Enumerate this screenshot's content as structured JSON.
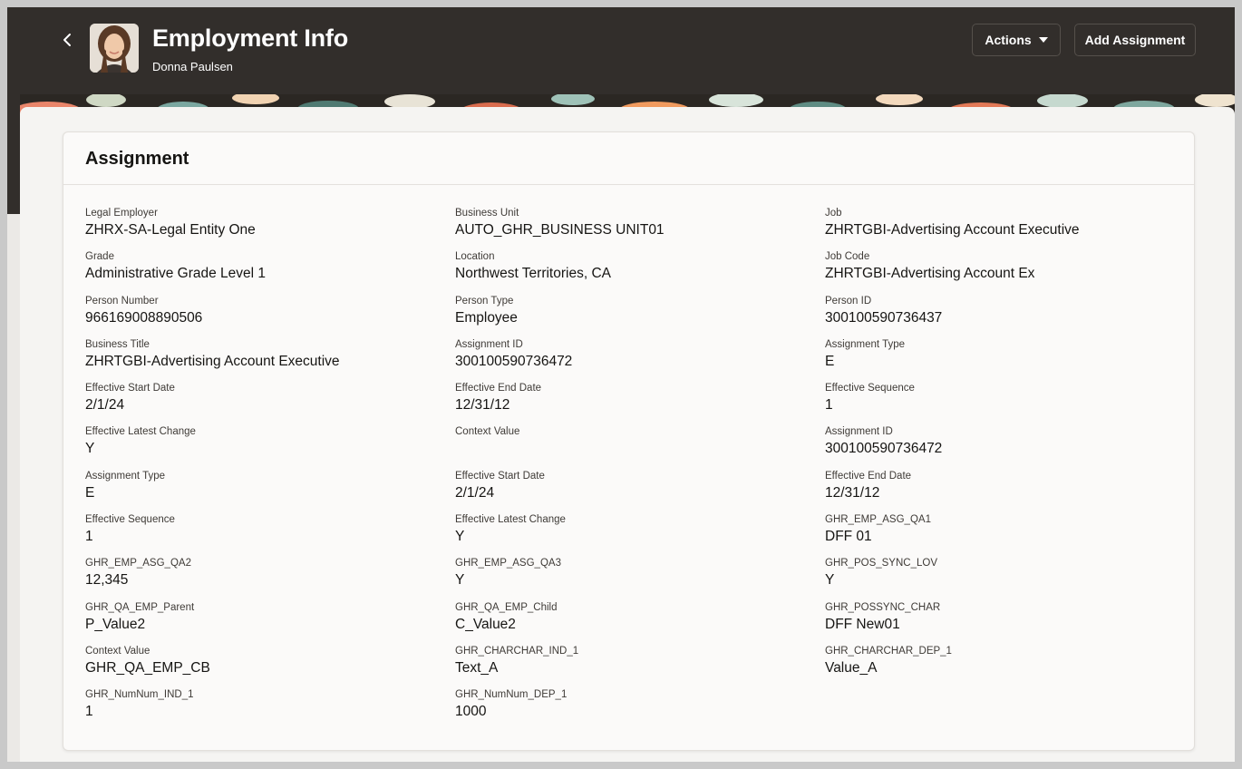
{
  "header": {
    "title": "Employment Info",
    "person_name": "Donna Paulsen",
    "actions_label": "Actions",
    "add_assignment_label": "Add Assignment"
  },
  "card": {
    "title": "Assignment",
    "fields": [
      {
        "label": "Legal Employer",
        "value": "ZHRX-SA-Legal Entity One"
      },
      {
        "label": "Business Unit",
        "value": "AUTO_GHR_BUSINESS UNIT01"
      },
      {
        "label": "Job",
        "value": "ZHRTGBI-Advertising Account Executive"
      },
      {
        "label": "Grade",
        "value": "Administrative Grade Level 1"
      },
      {
        "label": "Location",
        "value": "Northwest Territories, CA"
      },
      {
        "label": "Job Code",
        "value": "ZHRTGBI-Advertising Account Ex"
      },
      {
        "label": "Person Number",
        "value": "966169008890506"
      },
      {
        "label": "Person Type",
        "value": "Employee"
      },
      {
        "label": "Person ID",
        "value": "300100590736437"
      },
      {
        "label": "Business Title",
        "value": "ZHRTGBI-Advertising Account Executive"
      },
      {
        "label": "Assignment ID",
        "value": "300100590736472"
      },
      {
        "label": "Assignment Type",
        "value": "E"
      },
      {
        "label": "Effective Start Date",
        "value": "2/1/24"
      },
      {
        "label": "Effective End Date",
        "value": "12/31/12"
      },
      {
        "label": "Effective Sequence",
        "value": "1"
      },
      {
        "label": "Effective Latest Change",
        "value": "Y"
      },
      {
        "label": "Context Value",
        "value": ""
      },
      {
        "label": "Assignment ID",
        "value": "300100590736472"
      },
      {
        "label": "Assignment Type",
        "value": "E"
      },
      {
        "label": "Effective Start Date",
        "value": "2/1/24"
      },
      {
        "label": "Effective End Date",
        "value": "12/31/12"
      },
      {
        "label": "Effective Sequence",
        "value": "1"
      },
      {
        "label": "Effective Latest Change",
        "value": "Y"
      },
      {
        "label": "GHR_EMP_ASG_QA1",
        "value": "DFF 01"
      },
      {
        "label": "GHR_EMP_ASG_QA2",
        "value": "12,345"
      },
      {
        "label": "GHR_EMP_ASG_QA3",
        "value": "Y"
      },
      {
        "label": "GHR_POS_SYNC_LOV",
        "value": "Y"
      },
      {
        "label": "GHR_QA_EMP_Parent",
        "value": "P_Value2"
      },
      {
        "label": "GHR_QA_EMP_Child",
        "value": "C_Value2"
      },
      {
        "label": "GHR_POSSYNC_CHAR",
        "value": "DFF New01"
      },
      {
        "label": "Context Value",
        "value": "GHR_QA_EMP_CB"
      },
      {
        "label": "GHR_CHARCHAR_IND_1",
        "value": "Text_A"
      },
      {
        "label": "GHR_CHARCHAR_DEP_1",
        "value": "Value_A"
      },
      {
        "label": "GHR_NumNum_IND_1",
        "value": "1"
      },
      {
        "label": "GHR_NumNum_DEP_1",
        "value": "1000"
      }
    ]
  },
  "icons": {
    "back": "chevron-left-icon",
    "actions_caret": "caret-down-icon",
    "avatar": "person-photo"
  },
  "colors": {
    "header_bg": "#322e2b",
    "page_bg": "#f5f4f2",
    "card_bg": "#fbfaf9",
    "text_primary": "#161513"
  }
}
